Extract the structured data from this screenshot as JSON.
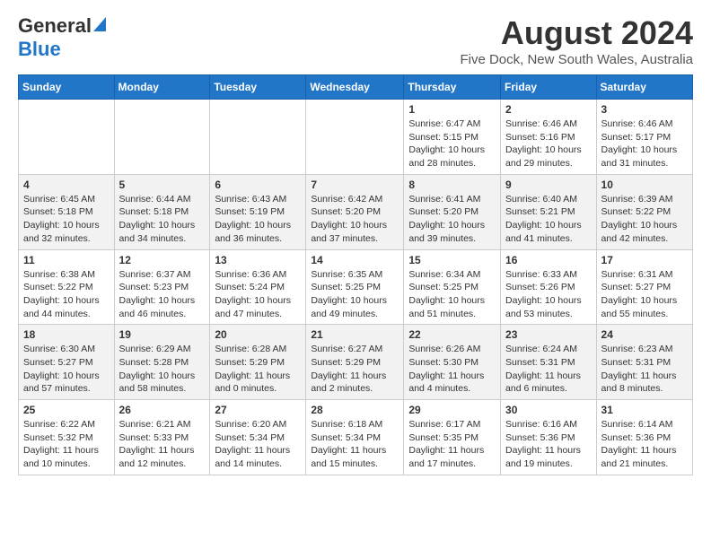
{
  "header": {
    "logo_general": "General",
    "logo_blue": "Blue",
    "title": "August 2024",
    "subtitle": "Five Dock, New South Wales, Australia"
  },
  "days_of_week": [
    "Sunday",
    "Monday",
    "Tuesday",
    "Wednesday",
    "Thursday",
    "Friday",
    "Saturday"
  ],
  "weeks": [
    {
      "days": [
        {
          "number": "",
          "info": ""
        },
        {
          "number": "",
          "info": ""
        },
        {
          "number": "",
          "info": ""
        },
        {
          "number": "",
          "info": ""
        },
        {
          "number": "1",
          "info": "Sunrise: 6:47 AM\nSunset: 5:15 PM\nDaylight: 10 hours and 28 minutes."
        },
        {
          "number": "2",
          "info": "Sunrise: 6:46 AM\nSunset: 5:16 PM\nDaylight: 10 hours and 29 minutes."
        },
        {
          "number": "3",
          "info": "Sunrise: 6:46 AM\nSunset: 5:17 PM\nDaylight: 10 hours and 31 minutes."
        }
      ]
    },
    {
      "days": [
        {
          "number": "4",
          "info": "Sunrise: 6:45 AM\nSunset: 5:18 PM\nDaylight: 10 hours and 32 minutes."
        },
        {
          "number": "5",
          "info": "Sunrise: 6:44 AM\nSunset: 5:18 PM\nDaylight: 10 hours and 34 minutes."
        },
        {
          "number": "6",
          "info": "Sunrise: 6:43 AM\nSunset: 5:19 PM\nDaylight: 10 hours and 36 minutes."
        },
        {
          "number": "7",
          "info": "Sunrise: 6:42 AM\nSunset: 5:20 PM\nDaylight: 10 hours and 37 minutes."
        },
        {
          "number": "8",
          "info": "Sunrise: 6:41 AM\nSunset: 5:20 PM\nDaylight: 10 hours and 39 minutes."
        },
        {
          "number": "9",
          "info": "Sunrise: 6:40 AM\nSunset: 5:21 PM\nDaylight: 10 hours and 41 minutes."
        },
        {
          "number": "10",
          "info": "Sunrise: 6:39 AM\nSunset: 5:22 PM\nDaylight: 10 hours and 42 minutes."
        }
      ]
    },
    {
      "days": [
        {
          "number": "11",
          "info": "Sunrise: 6:38 AM\nSunset: 5:22 PM\nDaylight: 10 hours and 44 minutes."
        },
        {
          "number": "12",
          "info": "Sunrise: 6:37 AM\nSunset: 5:23 PM\nDaylight: 10 hours and 46 minutes."
        },
        {
          "number": "13",
          "info": "Sunrise: 6:36 AM\nSunset: 5:24 PM\nDaylight: 10 hours and 47 minutes."
        },
        {
          "number": "14",
          "info": "Sunrise: 6:35 AM\nSunset: 5:25 PM\nDaylight: 10 hours and 49 minutes."
        },
        {
          "number": "15",
          "info": "Sunrise: 6:34 AM\nSunset: 5:25 PM\nDaylight: 10 hours and 51 minutes."
        },
        {
          "number": "16",
          "info": "Sunrise: 6:33 AM\nSunset: 5:26 PM\nDaylight: 10 hours and 53 minutes."
        },
        {
          "number": "17",
          "info": "Sunrise: 6:31 AM\nSunset: 5:27 PM\nDaylight: 10 hours and 55 minutes."
        }
      ]
    },
    {
      "days": [
        {
          "number": "18",
          "info": "Sunrise: 6:30 AM\nSunset: 5:27 PM\nDaylight: 10 hours and 57 minutes."
        },
        {
          "number": "19",
          "info": "Sunrise: 6:29 AM\nSunset: 5:28 PM\nDaylight: 10 hours and 58 minutes."
        },
        {
          "number": "20",
          "info": "Sunrise: 6:28 AM\nSunset: 5:29 PM\nDaylight: 11 hours and 0 minutes."
        },
        {
          "number": "21",
          "info": "Sunrise: 6:27 AM\nSunset: 5:29 PM\nDaylight: 11 hours and 2 minutes."
        },
        {
          "number": "22",
          "info": "Sunrise: 6:26 AM\nSunset: 5:30 PM\nDaylight: 11 hours and 4 minutes."
        },
        {
          "number": "23",
          "info": "Sunrise: 6:24 AM\nSunset: 5:31 PM\nDaylight: 11 hours and 6 minutes."
        },
        {
          "number": "24",
          "info": "Sunrise: 6:23 AM\nSunset: 5:31 PM\nDaylight: 11 hours and 8 minutes."
        }
      ]
    },
    {
      "days": [
        {
          "number": "25",
          "info": "Sunrise: 6:22 AM\nSunset: 5:32 PM\nDaylight: 11 hours and 10 minutes."
        },
        {
          "number": "26",
          "info": "Sunrise: 6:21 AM\nSunset: 5:33 PM\nDaylight: 11 hours and 12 minutes."
        },
        {
          "number": "27",
          "info": "Sunrise: 6:20 AM\nSunset: 5:34 PM\nDaylight: 11 hours and 14 minutes."
        },
        {
          "number": "28",
          "info": "Sunrise: 6:18 AM\nSunset: 5:34 PM\nDaylight: 11 hours and 15 minutes."
        },
        {
          "number": "29",
          "info": "Sunrise: 6:17 AM\nSunset: 5:35 PM\nDaylight: 11 hours and 17 minutes."
        },
        {
          "number": "30",
          "info": "Sunrise: 6:16 AM\nSunset: 5:36 PM\nDaylight: 11 hours and 19 minutes."
        },
        {
          "number": "31",
          "info": "Sunrise: 6:14 AM\nSunset: 5:36 PM\nDaylight: 11 hours and 21 minutes."
        }
      ]
    }
  ]
}
